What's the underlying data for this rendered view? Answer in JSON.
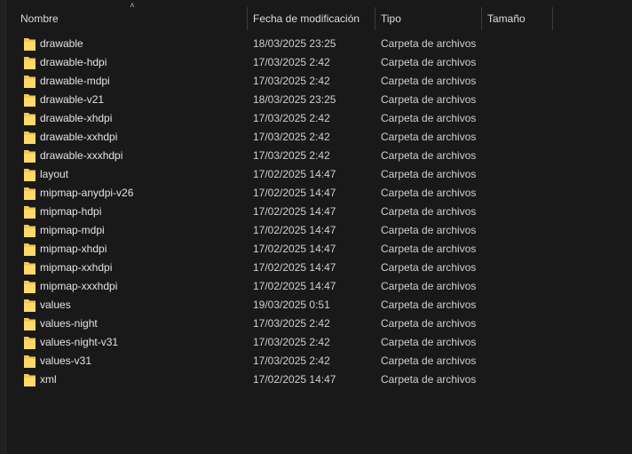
{
  "columns": {
    "name": "Nombre",
    "date": "Fecha de modificación",
    "type": "Tipo",
    "size": "Tamaño"
  },
  "colors": {
    "background": "#191919",
    "folder_body": "#f4c74f",
    "folder_front": "#ffd96a"
  },
  "rows": [
    {
      "name": "drawable",
      "date": "18/03/2025 23:25",
      "type": "Carpeta de archivos",
      "icon": "folder-icon"
    },
    {
      "name": "drawable-hdpi",
      "date": "17/03/2025 2:42",
      "type": "Carpeta de archivos",
      "icon": "folder-icon"
    },
    {
      "name": "drawable-mdpi",
      "date": "17/03/2025 2:42",
      "type": "Carpeta de archivos",
      "icon": "folder-icon"
    },
    {
      "name": "drawable-v21",
      "date": "18/03/2025 23:25",
      "type": "Carpeta de archivos",
      "icon": "folder-icon"
    },
    {
      "name": "drawable-xhdpi",
      "date": "17/03/2025 2:42",
      "type": "Carpeta de archivos",
      "icon": "folder-icon"
    },
    {
      "name": "drawable-xxhdpi",
      "date": "17/03/2025 2:42",
      "type": "Carpeta de archivos",
      "icon": "folder-icon"
    },
    {
      "name": "drawable-xxxhdpi",
      "date": "17/03/2025 2:42",
      "type": "Carpeta de archivos",
      "icon": "folder-icon"
    },
    {
      "name": "layout",
      "date": "17/02/2025 14:47",
      "type": "Carpeta de archivos",
      "icon": "folder-icon"
    },
    {
      "name": "mipmap-anydpi-v26",
      "date": "17/02/2025 14:47",
      "type": "Carpeta de archivos",
      "icon": "folder-icon"
    },
    {
      "name": "mipmap-hdpi",
      "date": "17/02/2025 14:47",
      "type": "Carpeta de archivos",
      "icon": "folder-icon"
    },
    {
      "name": "mipmap-mdpi",
      "date": "17/02/2025 14:47",
      "type": "Carpeta de archivos",
      "icon": "folder-icon"
    },
    {
      "name": "mipmap-xhdpi",
      "date": "17/02/2025 14:47",
      "type": "Carpeta de archivos",
      "icon": "folder-icon"
    },
    {
      "name": "mipmap-xxhdpi",
      "date": "17/02/2025 14:47",
      "type": "Carpeta de archivos",
      "icon": "folder-icon"
    },
    {
      "name": "mipmap-xxxhdpi",
      "date": "17/02/2025 14:47",
      "type": "Carpeta de archivos",
      "icon": "folder-icon"
    },
    {
      "name": "values",
      "date": "19/03/2025 0:51",
      "type": "Carpeta de archivos",
      "icon": "folder-icon"
    },
    {
      "name": "values-night",
      "date": "17/03/2025 2:42",
      "type": "Carpeta de archivos",
      "icon": "folder-icon"
    },
    {
      "name": "values-night-v31",
      "date": "17/03/2025 2:42",
      "type": "Carpeta de archivos",
      "icon": "folder-icon"
    },
    {
      "name": "values-v31",
      "date": "17/03/2025 2:42",
      "type": "Carpeta de archivos",
      "icon": "folder-icon"
    },
    {
      "name": "xml",
      "date": "17/02/2025 14:47",
      "type": "Carpeta de archivos",
      "icon": "folder-icon"
    }
  ]
}
